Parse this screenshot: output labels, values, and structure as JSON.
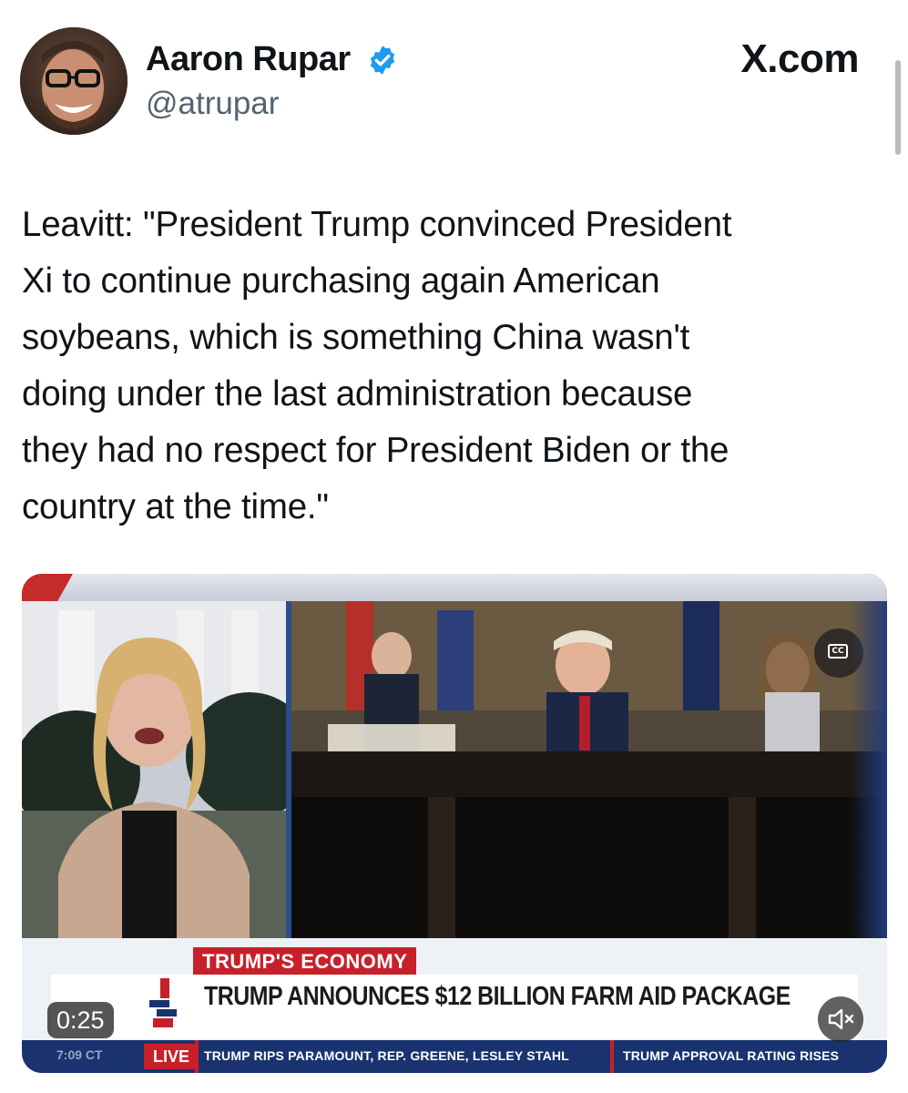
{
  "author": {
    "display_name": "Aaron Rupar",
    "handle": "@atrupar",
    "verified": true,
    "avatar": "profile-photo"
  },
  "site": "X.com",
  "tweet": {
    "lines": [
      "Leavitt: \"President Trump convinced President",
      "Xi to continue purchasing again American",
      "soybeans, which is something China wasn't",
      "doing under the last administration because",
      "they had no respect for President Biden or the",
      "country at the time.\""
    ]
  },
  "video": {
    "duration": "0:25",
    "cc_icon": "closed-captions-icon",
    "mute_icon": "speaker-muted-icon",
    "chyron": {
      "category": "TRUMP'S ECONOMY",
      "headline": "TRUMP ANNOUNCES $12 BILLION FARM AID PACKAGE",
      "live": "LIVE",
      "time": "7:09 CT",
      "ticker": [
        "TRUMP RIPS PARAMOUNT, REP. GREENE, LESLEY STAHL",
        "TRUMP APPROVAL RATING RISES"
      ]
    }
  },
  "colors": {
    "verified_blue": "#1d9bf0",
    "news_red": "#c8202a",
    "news_navy": "#1a3370"
  }
}
